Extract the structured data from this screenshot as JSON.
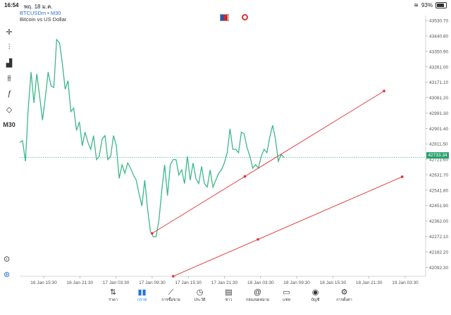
{
  "status_bar": {
    "time": "16:54",
    "date": "พฤ. 18 ม.ค.",
    "battery": "93%"
  },
  "symbol": {
    "name": "BTCUSDm • M30",
    "description": "Bitcoin vs US Dollar"
  },
  "toolbar": {
    "timeframe_label": "M30"
  },
  "chart_data": {
    "type": "line",
    "title": "BTCUSDm • M30",
    "subtitle": "Bitcoin vs US Dollar",
    "x_ticks": [
      "16 Jan 15:30",
      "16 Jan 21:30",
      "17 Jan 03:30",
      "17 Jan 09:30",
      "17 Jan 15:30",
      "17 Jan 21:30",
      "18 Jan 03:30",
      "18 Jan 09:30",
      "18 Jan 15:30",
      "18 Jan 21:30",
      "19 Jan 03:30"
    ],
    "y_ticks": [
      "43530.70",
      "43440.80",
      "43350.90",
      "43261.00",
      "43171.10",
      "43081.20",
      "42991.30",
      "42901.40",
      "42811.50",
      "42721.60",
      "42631.70",
      "42541.80",
      "42451.90",
      "42362.00",
      "42272.10",
      "42182.20",
      "42092.30"
    ],
    "ylim": [
      42040,
      43560
    ],
    "current_price": "42733.34",
    "line_color": "#3cb88a",
    "trend_line_color": "#e03030",
    "values": [
      42820,
      42830,
      42710,
      43020,
      43230,
      43050,
      43220,
      43090,
      42950,
      43080,
      43230,
      43150,
      43140,
      43420,
      43400,
      43280,
      43130,
      43180,
      43000,
      43020,
      42890,
      42940,
      42800,
      42880,
      42820,
      42780,
      42860,
      42720,
      42740,
      42840,
      42860,
      42720,
      42740,
      42860,
      42800,
      42610,
      42690,
      42640,
      42700,
      42670,
      42630,
      42600,
      42520,
      42450,
      42600,
      42430,
      42300,
      42270,
      42270,
      42370,
      42540,
      42690,
      42510,
      42690,
      42720,
      42720,
      42630,
      42660,
      42580,
      42740,
      42600,
      42700,
      42610,
      42580,
      42680,
      42580,
      42560,
      42660,
      42560,
      42600,
      42640,
      42660,
      42700,
      42760,
      42900,
      42780,
      42780,
      42760,
      42880,
      42870,
      42790,
      42740,
      42670,
      42690,
      42670,
      42740,
      42780,
      42760,
      42850,
      42920,
      42840,
      42710,
      42750,
      42733
    ],
    "trend_lines": [
      {
        "x": [
          "17 Jan 09:30",
          "19 Jan 00:00"
        ],
        "y": [
          42290,
          43120
        ]
      },
      {
        "x": [
          "17 Jan 13:00",
          "19 Jan 03:00"
        ],
        "y": [
          42040,
          42620
        ]
      }
    ]
  },
  "nav": [
    {
      "label": "ราคา",
      "icon": "arrows-icon"
    },
    {
      "label": "กราฟ",
      "icon": "candles-icon",
      "active": true
    },
    {
      "label": "การซื้อขาย",
      "icon": "trade-icon"
    },
    {
      "label": "ประวัติ",
      "icon": "history-icon"
    },
    {
      "label": "ข่าว",
      "icon": "news-icon"
    },
    {
      "label": "กล่องจดหมาย",
      "icon": "mail-icon"
    },
    {
      "label": "แชท",
      "icon": "chat-icon"
    },
    {
      "label": "บัญชี",
      "icon": "account-icon"
    },
    {
      "label": "การตั้งค่า",
      "icon": "settings-icon"
    }
  ]
}
